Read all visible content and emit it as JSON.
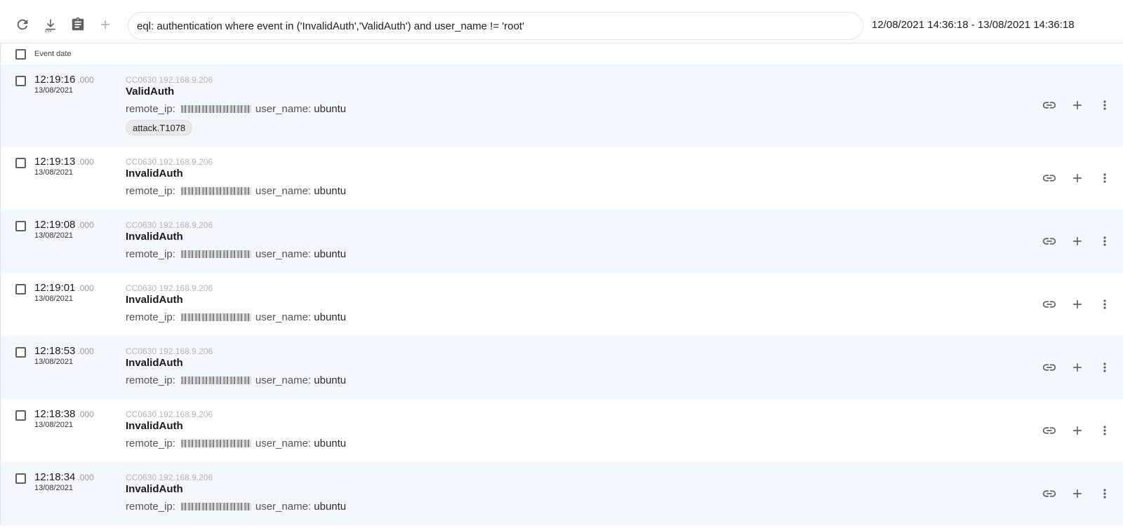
{
  "toolbar": {
    "refresh_icon": "refresh-icon",
    "download_csv_icon": "download-csv-icon",
    "csv_label": "csv",
    "clipboard_icon": "clipboard-icon",
    "add_icon": "add-icon",
    "query": "eql: authentication where event in ('InvalidAuth','ValidAuth') and user_name != 'root'",
    "date_range": "12/08/2021 14:36:18 - 13/08/2021 14:36:18"
  },
  "table": {
    "header_label": "Event date",
    "rows": [
      {
        "time": "12:19:16",
        "ms": ".000",
        "date": "13/08/2021",
        "host": "CC0630 192.168.9.206",
        "event": "ValidAuth",
        "remote_ip_key": "remote_ip:",
        "user_key": "user_name:",
        "user_value": "ubuntu",
        "tag": "attack.T1078"
      },
      {
        "time": "12:19:13",
        "ms": ".000",
        "date": "13/08/2021",
        "host": "CC0630 192.168.9.206",
        "event": "InvalidAuth",
        "remote_ip_key": "remote_ip:",
        "user_key": "user_name:",
        "user_value": "ubuntu"
      },
      {
        "time": "12:19:08",
        "ms": ".000",
        "date": "13/08/2021",
        "host": "CC0630 192.168.9.206",
        "event": "InvalidAuth",
        "remote_ip_key": "remote_ip:",
        "user_key": "user_name:",
        "user_value": "ubuntu"
      },
      {
        "time": "12:19:01",
        "ms": ".000",
        "date": "13/08/2021",
        "host": "CC0630 192.168.9.206",
        "event": "InvalidAuth",
        "remote_ip_key": "remote_ip:",
        "user_key": "user_name:",
        "user_value": "ubuntu"
      },
      {
        "time": "12:18:53",
        "ms": ".000",
        "date": "13/08/2021",
        "host": "CC0630 192.168.9.206",
        "event": "InvalidAuth",
        "remote_ip_key": "remote_ip:",
        "user_key": "user_name:",
        "user_value": "ubuntu"
      },
      {
        "time": "12:18:38",
        "ms": ".000",
        "date": "13/08/2021",
        "host": "CC0630 192.168.9.206",
        "event": "InvalidAuth",
        "remote_ip_key": "remote_ip:",
        "user_key": "user_name:",
        "user_value": "ubuntu"
      },
      {
        "time": "12:18:34",
        "ms": ".000",
        "date": "13/08/2021",
        "host": "CC0630 192.168.9.206",
        "event": "InvalidAuth",
        "remote_ip_key": "remote_ip:",
        "user_key": "user_name:",
        "user_value": "ubuntu"
      }
    ],
    "row_actions": [
      "link-icon",
      "add-icon",
      "more-vert-icon"
    ]
  },
  "colors": {
    "row_alt_background": "#f4f7fd",
    "icon_color": "#5f6368",
    "muted_text": "#b5b5b5"
  }
}
